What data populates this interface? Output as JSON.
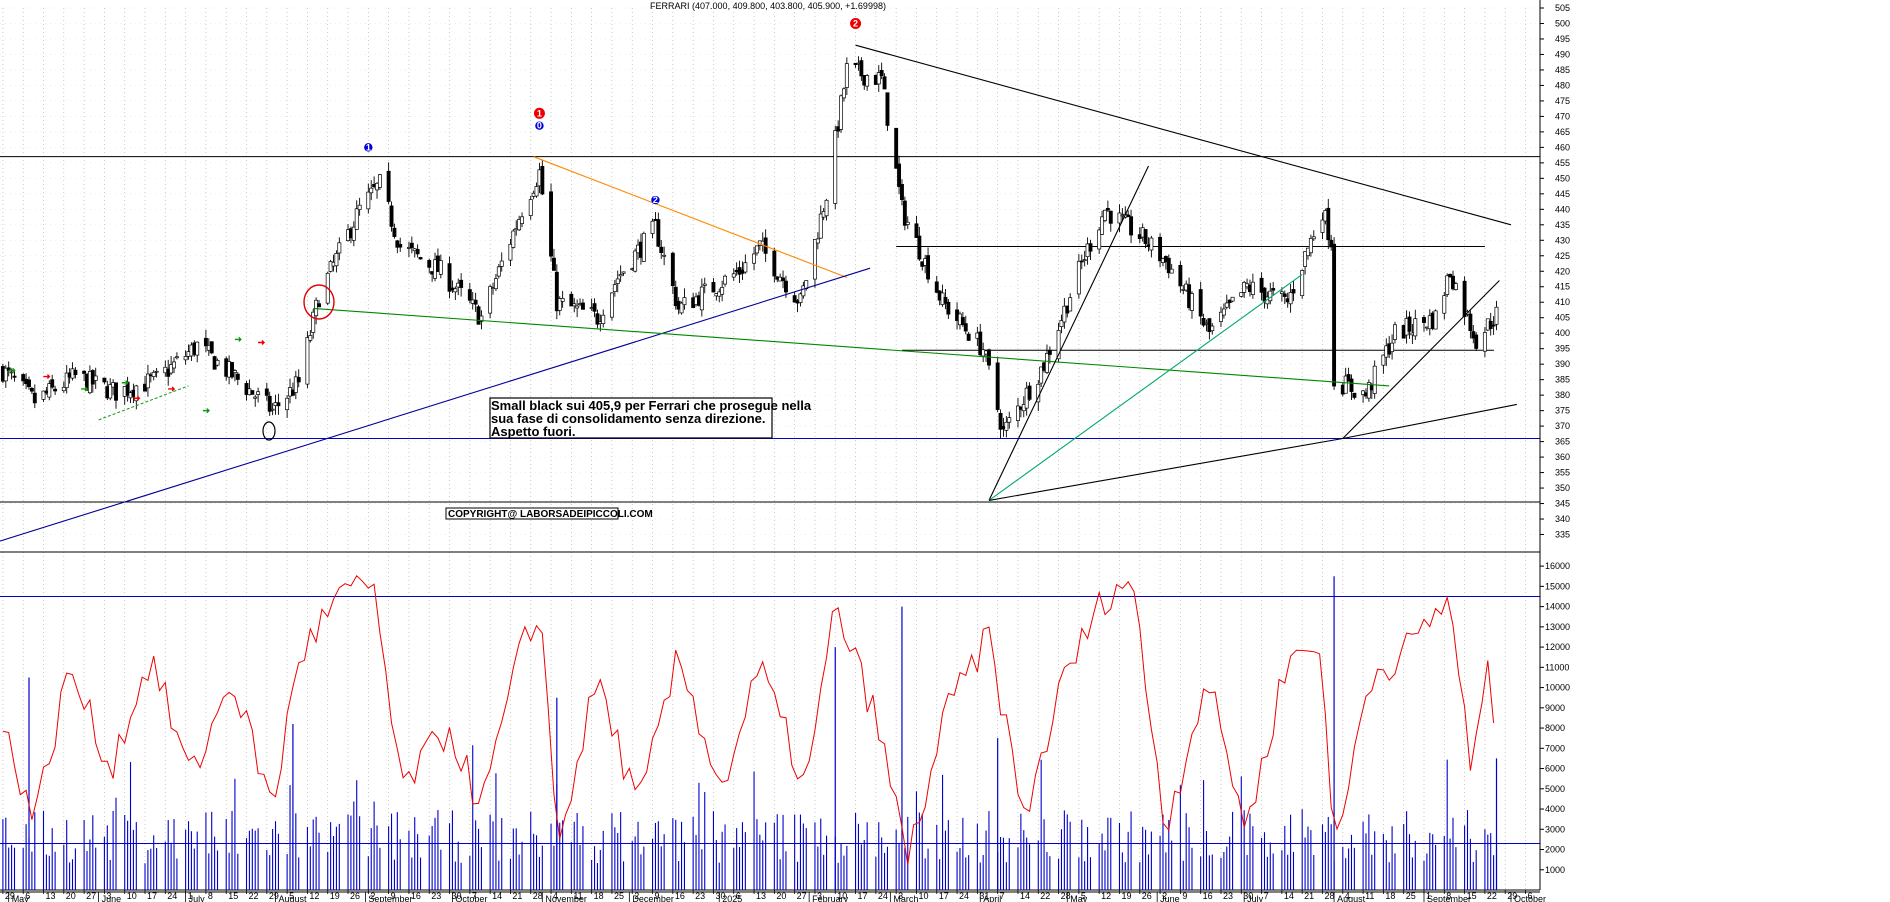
{
  "chart_data": {
    "type": "candlestick",
    "title": "FERRARI (407.000, 409.800, 403.800, 405.900, +1.69998)",
    "annotation": [
      "Small black sui 405,9 per Ferrari che prosegue nella",
      "sua fase di consolidamento senza direzione.",
      "Aspetto fuori."
    ],
    "copyright": "COPYRIGHT@ LABORSADEIPICCOLI.COM",
    "ylim": [
      330,
      505
    ],
    "y_ticks": [
      505,
      500,
      495,
      490,
      485,
      480,
      475,
      470,
      465,
      460,
      455,
      450,
      445,
      440,
      435,
      430,
      425,
      420,
      415,
      410,
      405,
      400,
      395,
      390,
      385,
      380,
      375,
      370,
      365,
      360,
      355,
      350,
      345,
      340,
      335
    ],
    "volume_ticks": [
      16000,
      15000,
      14000,
      13000,
      12000,
      11000,
      10000,
      9000,
      8000,
      7000,
      6000,
      5000,
      4000,
      3000,
      2000,
      1000
    ],
    "volume_ylim": [
      0,
      16500
    ],
    "day_labels": [
      "29",
      "6",
      "13",
      "20",
      "27",
      "3",
      "10",
      "17",
      "24",
      "1",
      "8",
      "15",
      "22",
      "29",
      "5",
      "12",
      "19",
      "26",
      "2",
      "9",
      "16",
      "23",
      "30",
      "7",
      "14",
      "21",
      "28",
      "4",
      "11",
      "18",
      "25",
      "2",
      "9",
      "16",
      "23",
      "30",
      "6",
      "13",
      "20",
      "27",
      "3",
      "10",
      "17",
      "24",
      "3",
      "10",
      "17",
      "24",
      "31",
      "7",
      "14",
      "22",
      "28",
      "5",
      "12",
      "19",
      "26",
      "2",
      "9",
      "16",
      "23",
      "30",
      "7",
      "14",
      "21",
      "28",
      "4",
      "11",
      "18",
      "25",
      "1",
      "8",
      "15",
      "22",
      "29",
      "6"
    ],
    "month_labels": [
      "May",
      "June",
      "July",
      "August",
      "September",
      "October",
      "November",
      "December",
      "2025",
      "February",
      "March",
      "April",
      "May",
      "June",
      "July",
      "August",
      "September",
      "October"
    ],
    "markers": [
      {
        "label": "1",
        "color": "#0000dd",
        "date": "2024-09-02",
        "price": 460
      },
      {
        "label": "1",
        "color": "#ee0000",
        "date": "2024-10-31",
        "price": 471
      },
      {
        "label": "0",
        "color": "#0000dd",
        "date": "2024-10-31",
        "price": 467
      },
      {
        "label": "2",
        "color": "#0000dd",
        "date": "2024-12-10",
        "price": 443
      },
      {
        "label": "2",
        "color": "#ee0000",
        "date": "2025-02-17",
        "price": 500
      }
    ],
    "horizontal_levels": [
      {
        "price": 457,
        "color": "#000000"
      },
      {
        "price": 345.5,
        "color": "#000000"
      },
      {
        "price": 366,
        "color": "#0000cc"
      },
      {
        "price": 394.5,
        "color": "#000000"
      },
      {
        "price": 428,
        "color": "#000000"
      }
    ],
    "trendlines": [
      {
        "color": "#000000",
        "points": [
          [
            "2025-02-17",
            493
          ],
          [
            "2025-10-01",
            435
          ]
        ]
      },
      {
        "color": "#ff8800",
        "points": [
          [
            "2024-10-29",
            457
          ],
          [
            "2025-02-14",
            418
          ]
        ]
      },
      {
        "color": "#000099",
        "points": [
          [
            "2024-04-25",
            332
          ],
          [
            "2025-02-22",
            421
          ]
        ]
      },
      {
        "color": "#008800",
        "points": [
          [
            "2024-08-14",
            408
          ],
          [
            "2025-08-20",
            383
          ]
        ]
      },
      {
        "color": "#000000",
        "points": [
          [
            "2025-04-04",
            346
          ],
          [
            "2025-05-29",
            454
          ]
        ]
      },
      {
        "color": "#00aa66",
        "points": [
          [
            "2025-04-04",
            346
          ],
          [
            "2025-07-21",
            419
          ]
        ]
      },
      {
        "color": "#000000",
        "points": [
          [
            "2025-04-04",
            346
          ],
          [
            "2025-08-04",
            366
          ],
          [
            "2025-10-03",
            377
          ]
        ]
      },
      {
        "color": "#000000",
        "points": [
          [
            "2025-08-04",
            366
          ],
          [
            "2025-09-27",
            417
          ]
        ]
      }
    ],
    "candles_anchor": [
      [
        "2024-04-29",
        388
      ],
      [
        "2024-05-10",
        378
      ],
      [
        "2024-05-24",
        386
      ],
      [
        "2024-06-07",
        381
      ],
      [
        "2024-06-21",
        385
      ],
      [
        "2024-07-05",
        396
      ],
      [
        "2024-07-19",
        385
      ],
      [
        "2024-07-31",
        375
      ],
      [
        "2024-08-09",
        384
      ],
      [
        "2024-08-16",
        412
      ],
      [
        "2024-08-30",
        440
      ],
      [
        "2024-09-06",
        448
      ],
      [
        "2024-09-13",
        428
      ],
      [
        "2024-09-27",
        420
      ],
      [
        "2024-10-11",
        405
      ],
      [
        "2024-10-25",
        440
      ],
      [
        "2024-10-31",
        452
      ],
      [
        "2024-11-06",
        410
      ],
      [
        "2024-11-20",
        405
      ],
      [
        "2024-11-27",
        418
      ],
      [
        "2024-12-10",
        434
      ],
      [
        "2024-12-18",
        408
      ],
      [
        "2025-01-08",
        420
      ],
      [
        "2025-01-15",
        428
      ],
      [
        "2025-01-29",
        410
      ],
      [
        "2025-02-07",
        445
      ],
      [
        "2025-02-14",
        485
      ],
      [
        "2025-02-26",
        482
      ],
      [
        "2025-03-05",
        440
      ],
      [
        "2025-03-19",
        410
      ],
      [
        "2025-04-02",
        395
      ],
      [
        "2025-04-09",
        368
      ],
      [
        "2025-04-23",
        390
      ],
      [
        "2025-05-07",
        425
      ],
      [
        "2025-05-14",
        440
      ],
      [
        "2025-05-28",
        430
      ],
      [
        "2025-06-05",
        422
      ],
      [
        "2025-06-19",
        400
      ],
      [
        "2025-07-02",
        415
      ],
      [
        "2025-07-16",
        410
      ],
      [
        "2025-07-28",
        440
      ],
      [
        "2025-07-31",
        430
      ],
      [
        "2025-08-01",
        385
      ],
      [
        "2025-08-12",
        380
      ],
      [
        "2025-08-22",
        400
      ],
      [
        "2025-09-05",
        405
      ],
      [
        "2025-09-10",
        420
      ],
      [
        "2025-09-19",
        398
      ],
      [
        "2025-09-26",
        406
      ]
    ],
    "volume_envelope": [
      [
        "2024-04-29",
        8000
      ],
      [
        "2024-05-10",
        3500
      ],
      [
        "2024-05-22",
        11000
      ],
      [
        "2024-06-05",
        6000
      ],
      [
        "2024-06-19",
        11500
      ],
      [
        "2024-07-03",
        5500
      ],
      [
        "2024-07-17",
        10500
      ],
      [
        "2024-07-31",
        4000
      ],
      [
        "2024-08-09",
        11500
      ],
      [
        "2024-08-23",
        14500
      ],
      [
        "2024-09-04",
        15000
      ],
      [
        "2024-09-13",
        5000
      ],
      [
        "2024-09-30",
        8000
      ],
      [
        "2024-10-11",
        4000
      ],
      [
        "2024-10-25",
        12000
      ],
      [
        "2024-11-01",
        13500
      ],
      [
        "2024-11-06",
        2000
      ],
      [
        "2024-11-20",
        10500
      ],
      [
        "2024-12-04",
        4000
      ],
      [
        "2024-12-18",
        11500
      ],
      [
        "2025-01-02",
        5000
      ],
      [
        "2025-01-15",
        11000
      ],
      [
        "2025-01-31",
        5000
      ],
      [
        "2025-02-10",
        14000
      ],
      [
        "2025-02-24",
        8500
      ],
      [
        "2025-03-07",
        1500
      ],
      [
        "2025-03-21",
        9000
      ],
      [
        "2025-04-04",
        12500
      ],
      [
        "2025-04-16",
        3500
      ],
      [
        "2025-04-30",
        10500
      ],
      [
        "2025-05-14",
        14500
      ],
      [
        "2025-05-23",
        15500
      ],
      [
        "2025-06-04",
        3000
      ],
      [
        "2025-06-18",
        10500
      ],
      [
        "2025-07-02",
        3000
      ],
      [
        "2025-07-16",
        11500
      ],
      [
        "2025-07-28",
        12000
      ],
      [
        "2025-08-01",
        1500
      ],
      [
        "2025-08-13",
        10500
      ],
      [
        "2025-08-27",
        12000
      ],
      [
        "2025-09-10",
        14500
      ],
      [
        "2025-09-17",
        6000
      ],
      [
        "2025-09-23",
        10500
      ],
      [
        "2025-09-26",
        7500
      ]
    ],
    "volume_bar_base": 2200,
    "volume_spikes": [
      [
        "2024-05-08",
        10500
      ],
      [
        "2024-08-07",
        8200
      ],
      [
        "2024-11-06",
        9500
      ],
      [
        "2025-02-10",
        12000
      ],
      [
        "2025-03-05",
        14000
      ],
      [
        "2025-04-07",
        7500
      ],
      [
        "2025-08-01",
        15500
      ],
      [
        "2025-09-26",
        6500
      ]
    ]
  }
}
